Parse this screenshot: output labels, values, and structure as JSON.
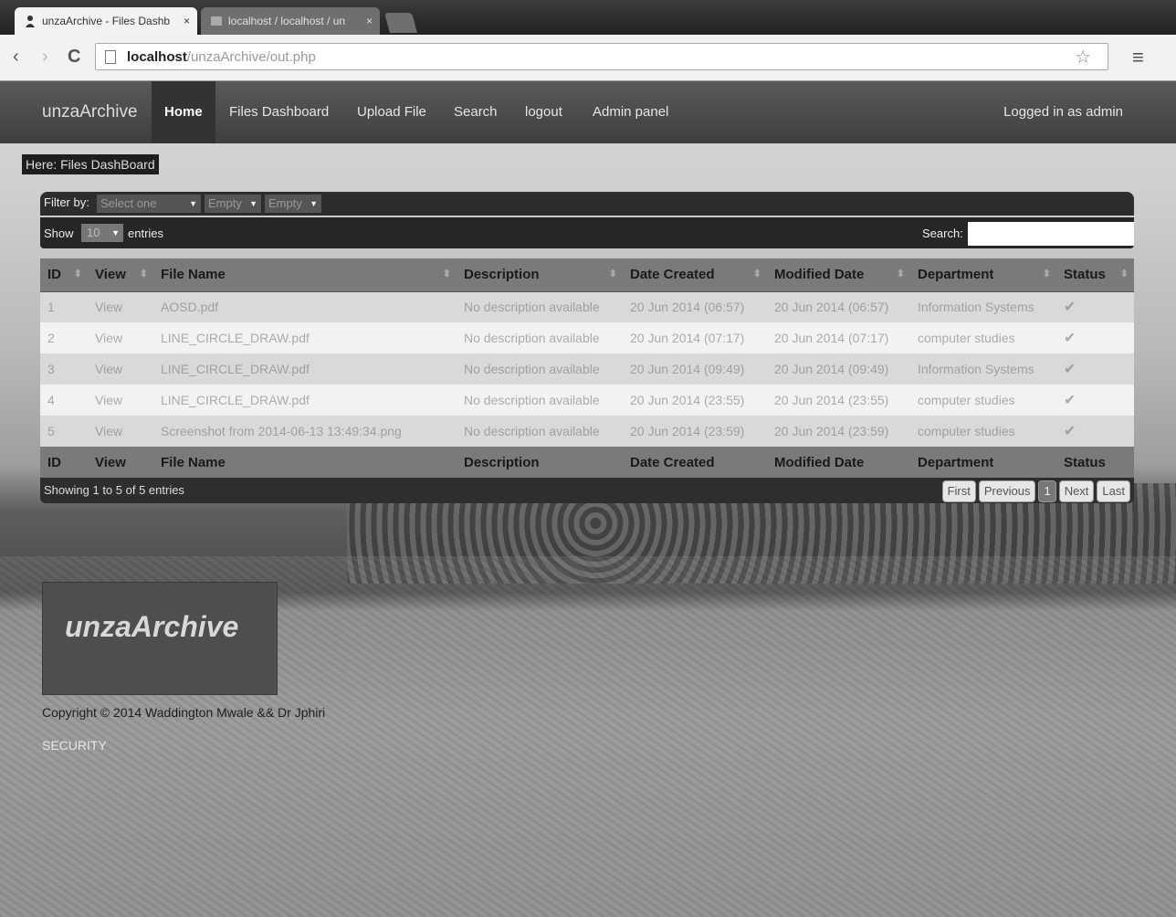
{
  "browser": {
    "tabs": [
      {
        "title": "unzaArchive - Files Dashb",
        "close": "×"
      },
      {
        "title": "localhost / localhost / un",
        "close": "×"
      }
    ],
    "url_host": "localhost",
    "url_path": "/unzaArchive/out.php",
    "back": "‹",
    "forward": "›",
    "reload": "C",
    "star": "☆",
    "menu": "≡"
  },
  "navbar": {
    "brand": "unzaArchive",
    "items": [
      "Home",
      "Files Dashboard",
      "Upload File",
      "Search",
      "logout",
      "Admin panel"
    ],
    "active": "Home",
    "logged_in": "Logged in as admin"
  },
  "breadcrumb": "Here: Files DashBoard",
  "filter": {
    "label": "Filter by:",
    "select1": "Select one",
    "select2": "Empty",
    "select3": "Empty"
  },
  "show": {
    "label_before": "Show",
    "value": "10",
    "label_after": "entries",
    "search_label": "Search:"
  },
  "table": {
    "columns": [
      "ID",
      "View",
      "File Name",
      "Description",
      "Date Created",
      "Modified Date",
      "Department",
      "Status"
    ],
    "rows": [
      {
        "id": "1",
        "view": "View",
        "file": "AOSD.pdf",
        "desc": "No description available",
        "created": "20 Jun 2014 (06:57)",
        "modified": "20 Jun 2014 (06:57)",
        "dept": "Information Systems",
        "status": "✔"
      },
      {
        "id": "2",
        "view": "View",
        "file": "LINE_CIRCLE_DRAW.pdf",
        "desc": "No description available",
        "created": "20 Jun 2014 (07:17)",
        "modified": "20 Jun 2014 (07:17)",
        "dept": "computer studies",
        "status": "✔"
      },
      {
        "id": "3",
        "view": "View",
        "file": "LINE_CIRCLE_DRAW.pdf",
        "desc": "No description available",
        "created": "20 Jun 2014 (09:49)",
        "modified": "20 Jun 2014 (09:49)",
        "dept": "Information Systems",
        "status": "✔"
      },
      {
        "id": "4",
        "view": "View",
        "file": "LINE_CIRCLE_DRAW.pdf",
        "desc": "No description available",
        "created": "20 Jun 2014 (23:55)",
        "modified": "20 Jun 2014 (23:55)",
        "dept": "computer studies",
        "status": "✔"
      },
      {
        "id": "5",
        "view": "View",
        "file": "Screenshot from 2014-06-13 13:49:34.png",
        "desc": "No description available",
        "created": "20 Jun 2014 (23:59)",
        "modified": "20 Jun 2014 (23:59)",
        "dept": "computer studies",
        "status": "✔"
      }
    ],
    "info": "Showing 1 to 5 of 5 entries",
    "pager": [
      "First",
      "Previous",
      "1",
      "Next",
      "Last"
    ]
  },
  "footer": {
    "logo": "unzaArchive",
    "copyright": "Copyright © 2014 Waddington Mwale && Dr Jphiri",
    "security": "SECURITY"
  }
}
